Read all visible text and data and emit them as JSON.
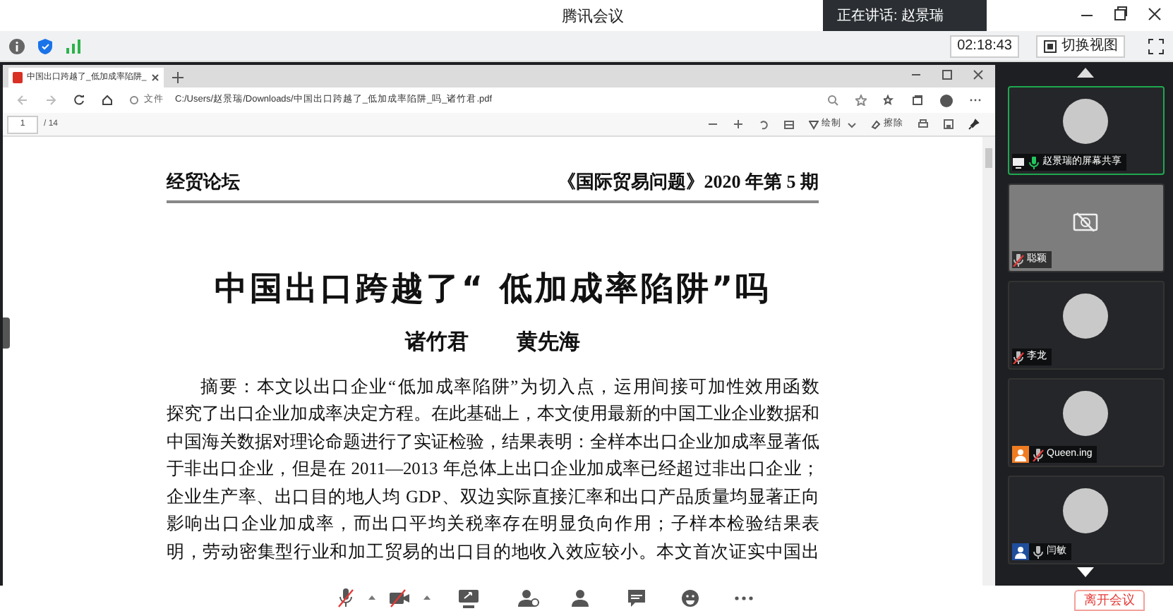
{
  "app": {
    "title": "腾讯会议",
    "speaking": "正在讲话: 赵景瑞",
    "time": "02:18:43",
    "view_button": "切换视图"
  },
  "browser": {
    "tab": "中国出口跨越了_低加成率陷阱_",
    "address_label": "文件",
    "address": "C:/Users/赵景瑞/Downloads/中国出口跨越了_低加成率陷阱_吗_诸竹君.pdf",
    "page": "1",
    "page_total": "/ 14",
    "draw": "绘制",
    "erase": "擦除"
  },
  "document": {
    "section": "经贸论坛",
    "journal": "《国际贸易问题》2020 年第 5 期",
    "title": "中国出口跨越了“ 低加成率陷阱”吗",
    "authors": [
      "诸竹君",
      "黄先海"
    ],
    "lines": [
      "摘要：本文以出口企业“低加成率陷阱”为切入点，运用间接可加性效用函数",
      "探究了出口企业加成率决定方程。在此基础上，本文使用最新的中国工业企业数据和",
      "中国海关数据对理论命题进行了实证检验，结果表明：全样本出口企业加成率显著低",
      "于非出口企业，但是在 2011—2013 年总体上出口企业加成率已经超过非出口企业；",
      "企业生产率、出口目的地人均 GDP、双边实际直接汇率和出口产品质量均显著正向",
      "影响出口企业加成率，而出口平均关税率存在明显负向作用；子样本检验结果表",
      "明，劳动密集型行业和加工贸易的出口目的地收入效应较小。本文首次证实中国出"
    ]
  },
  "participants": [
    {
      "name": "赵景瑞的屏幕共享",
      "kind": "avatar",
      "muted": false,
      "talking": true,
      "sharing": true,
      "selected": true
    },
    {
      "name": "聪颖",
      "kind": "camera_off",
      "muted": true,
      "talking": false,
      "sharing": false,
      "selected": false
    },
    {
      "name": "李龙",
      "kind": "avatar",
      "muted": true,
      "talking": false,
      "sharing": false,
      "selected": false
    },
    {
      "name": "Queen.ing",
      "kind": "avatar",
      "muted": true,
      "talking": false,
      "sharing": false,
      "selected": false,
      "color": "#f07c22"
    },
    {
      "name": "闫敏",
      "kind": "avatar",
      "muted": false,
      "talking": false,
      "sharing": false,
      "selected": false,
      "color": "#1f4e9c"
    }
  ],
  "toolbar": [
    {
      "kind": "mic",
      "muted": true
    },
    {
      "kind": "caret"
    },
    {
      "kind": "camera",
      "muted": true
    },
    {
      "kind": "caret"
    },
    {
      "kind": "share"
    },
    {
      "kind": "invite"
    },
    {
      "kind": "members"
    },
    {
      "kind": "chat"
    },
    {
      "kind": "emoji"
    },
    {
      "kind": "more"
    }
  ],
  "leave_button": "离开会议"
}
